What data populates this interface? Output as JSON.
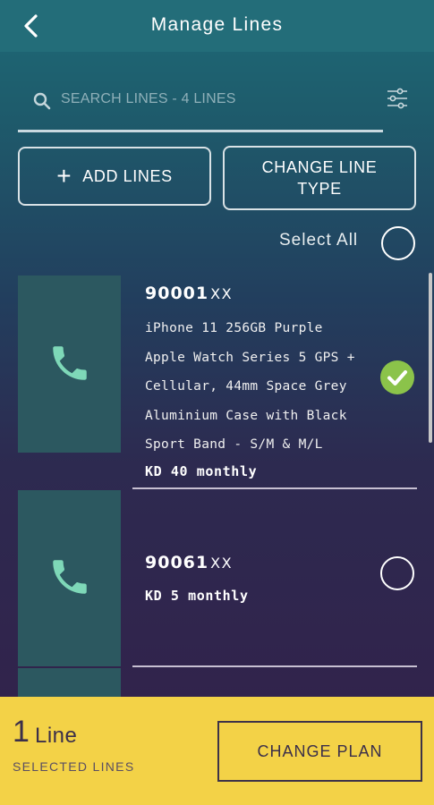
{
  "header": {
    "title": "Manage Lines",
    "back_icon": "chevron-left-icon"
  },
  "search": {
    "placeholder": "SEARCH LINES - 4 LINES",
    "icon": "search-icon",
    "filter_icon": "sliders-icon"
  },
  "actions": {
    "add_icon": "plus-icon",
    "add_label": "ADD LINES",
    "change_type_label": "CHANGE LINE TYPE"
  },
  "select_all": {
    "label": "Select All",
    "checked": false
  },
  "lines": [
    {
      "number": "90001",
      "masked": "XX",
      "items": [
        "iPhone 11 256GB Purple",
        "Apple Watch Series 5 GPS +",
        "Cellular, 44mm Space Grey",
        "Aluminium Case with Black",
        "Sport Band - S/M & M/L"
      ],
      "price": "KD 40 monthly",
      "selected": true
    },
    {
      "number": "90061",
      "masked": "XX",
      "items": [],
      "price": "KD 5 monthly",
      "selected": false
    }
  ],
  "footer": {
    "count": "1",
    "count_unit": "Line",
    "subtitle": "SELECTED LINES",
    "change_plan_label": "CHANGE PLAN"
  },
  "colors": {
    "accent_yellow": "#f3d247",
    "check_green": "#8bc34a",
    "icon_teal": "#7ed8b8"
  }
}
